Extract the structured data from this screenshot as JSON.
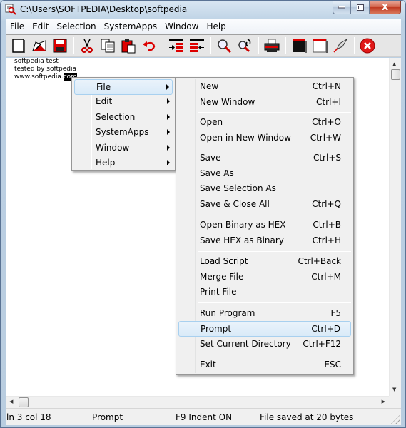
{
  "window": {
    "title": "C:\\Users\\SOFTPEDIA\\Desktop\\softpedia",
    "controls": {
      "minimize": "–",
      "maximize": "□",
      "close": "X"
    }
  },
  "menubar": [
    "File",
    "Edit",
    "Selection",
    "SystemApps",
    "Window",
    "Help"
  ],
  "toolbar": {
    "buttons": [
      {
        "name": "new-icon"
      },
      {
        "name": "open-icon"
      },
      {
        "name": "save-icon"
      },
      {
        "name": "cut-icon"
      },
      {
        "name": "copy-icon"
      },
      {
        "name": "paste-icon"
      },
      {
        "name": "undo-icon"
      },
      {
        "name": "indent-icon"
      },
      {
        "name": "unindent-icon"
      },
      {
        "name": "find-icon"
      },
      {
        "name": "replace-icon"
      },
      {
        "name": "print-icon"
      },
      {
        "name": "black-window-icon"
      },
      {
        "name": "white-window-icon"
      },
      {
        "name": "run-rocket-icon"
      },
      {
        "name": "exit-icon"
      }
    ]
  },
  "editor": {
    "lines": [
      "softpedia test",
      "tested by softpedia",
      "www.softpedia."
    ],
    "selected_text": "com"
  },
  "context_menu": {
    "items": [
      {
        "label": "File",
        "submenu": true,
        "highlighted": true
      },
      {
        "label": "Edit",
        "submenu": true
      },
      {
        "label": "Selection",
        "submenu": true
      },
      {
        "label": "SystemApps",
        "submenu": true
      },
      {
        "label": "Window",
        "submenu": true
      },
      {
        "label": "Help",
        "submenu": true
      }
    ]
  },
  "file_menu": {
    "items": [
      {
        "label": "New",
        "shortcut": "Ctrl+N"
      },
      {
        "label": "New Window",
        "shortcut": "Ctrl+I"
      },
      {
        "label": "Open",
        "shortcut": "Ctrl+O"
      },
      {
        "label": "Open in New Window",
        "shortcut": "Ctrl+W"
      },
      {
        "label": "Save",
        "shortcut": "Ctrl+S"
      },
      {
        "label": "Save As",
        "shortcut": ""
      },
      {
        "label": "Save Selection As",
        "shortcut": ""
      },
      {
        "label": "Save & Close All",
        "shortcut": "Ctrl+Q"
      },
      {
        "label": "Open Binary as HEX",
        "shortcut": "Ctrl+B"
      },
      {
        "label": "Save HEX as Binary",
        "shortcut": "Ctrl+H"
      },
      {
        "label": "Load Script",
        "shortcut": "Ctrl+Back"
      },
      {
        "label": "Merge File",
        "shortcut": "Ctrl+M"
      },
      {
        "label": "Print File",
        "shortcut": ""
      },
      {
        "label": "Run Program",
        "shortcut": "F5"
      },
      {
        "label": "Prompt",
        "shortcut": "Ctrl+D",
        "highlighted": true
      },
      {
        "label": "Set Current Directory",
        "shortcut": "Ctrl+F12"
      },
      {
        "label": "Exit",
        "shortcut": "ESC"
      }
    ]
  },
  "statusbar": {
    "position": "ln 3 col 18",
    "mode": "Prompt",
    "indent": "F9 Indent ON",
    "save_status": "File saved at  20 bytes"
  }
}
